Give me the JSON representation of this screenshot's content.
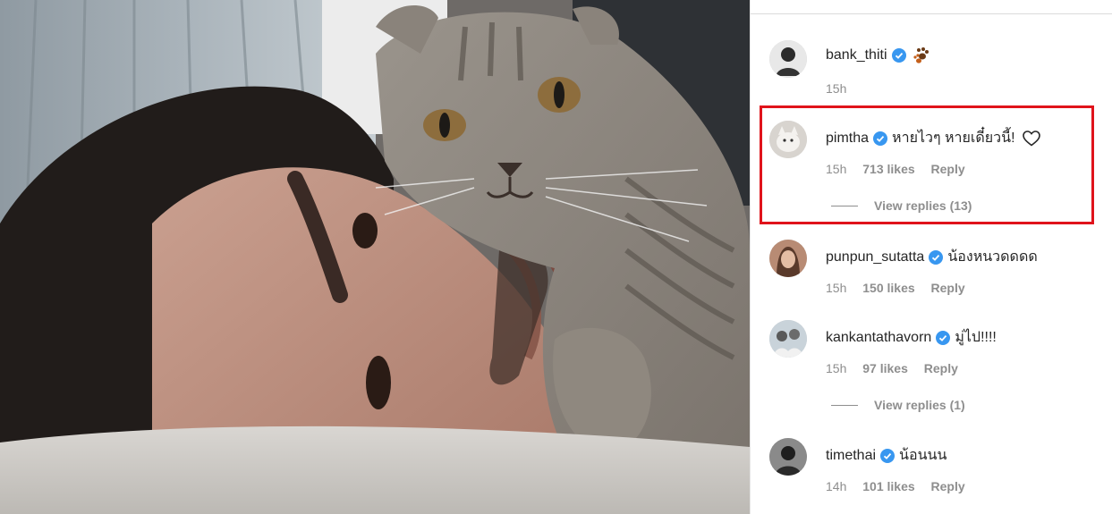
{
  "comments": [
    {
      "username": "bank_thiti",
      "text": "",
      "emoji": "paw-prints-icon",
      "time": "15h",
      "likes": "",
      "reply": "",
      "view_replies": ""
    },
    {
      "username": "pimtha",
      "text": "หายไวๆ หายเดี๋ยวนี้!",
      "emoji": "heart-outline-icon",
      "time": "15h",
      "likes": "713 likes",
      "reply": "Reply",
      "view_replies": "View replies (13)",
      "highlighted": true
    },
    {
      "username": "punpun_sutatta",
      "text": "น้องหนวดดดด",
      "time": "15h",
      "likes": "150 likes",
      "reply": "Reply",
      "view_replies": ""
    },
    {
      "username": "kankantathavorn",
      "text": "มู่ไป!!!!",
      "time": "15h",
      "likes": "97 likes",
      "reply": "Reply",
      "view_replies": "View replies (1)"
    },
    {
      "username": "timethai",
      "text": "น้อนนน",
      "time": "14h",
      "likes": "101 likes",
      "reply": "Reply",
      "view_replies": ""
    }
  ],
  "colors": {
    "verified_badge": "#3897f0",
    "highlight_border": "#e0131b",
    "meta_text": "#8e8e8e",
    "primary_text": "#262626"
  }
}
